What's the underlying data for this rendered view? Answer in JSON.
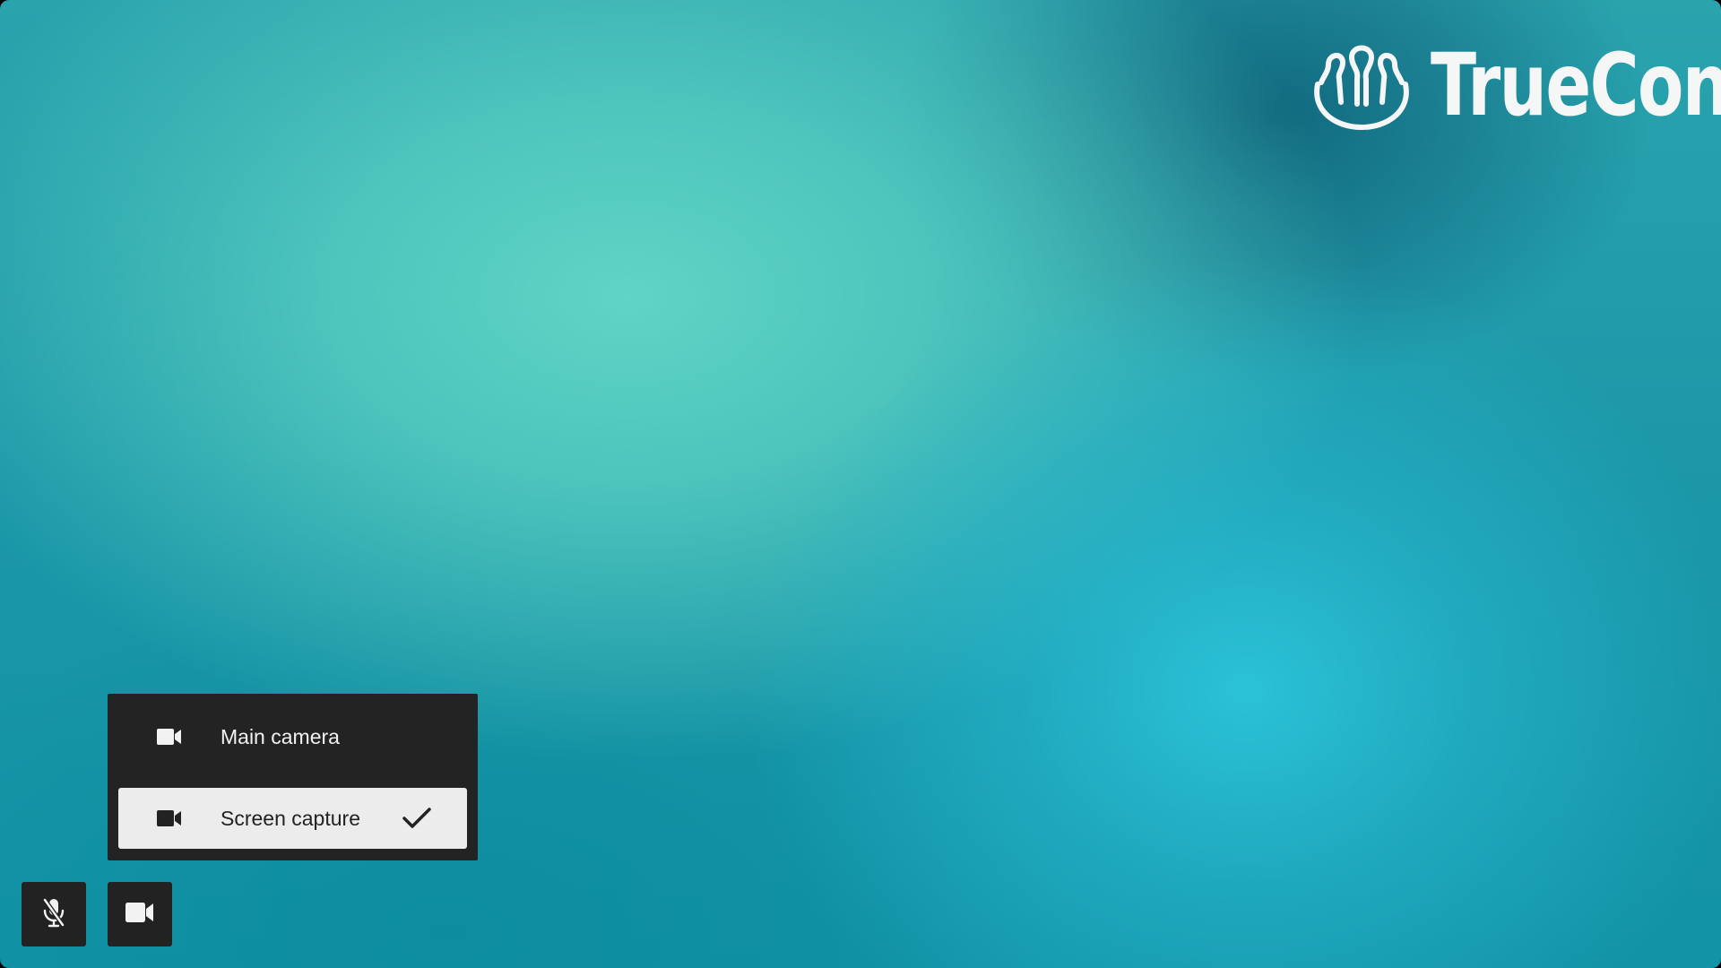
{
  "brand": {
    "name": "TrueConf",
    "logo_icon": "three-people-icon"
  },
  "source_menu": {
    "items": [
      {
        "label": "Main camera",
        "icon": "video-camera-icon",
        "selected": false
      },
      {
        "label": "Screen capture",
        "icon": "video-camera-icon",
        "selected": true
      }
    ]
  },
  "toolbar": {
    "microphone": {
      "icon": "microphone-muted-icon",
      "state": "muted"
    },
    "camera": {
      "icon": "video-camera-icon"
    }
  },
  "colors": {
    "panel": "#232323",
    "selected_item": "#ececec",
    "background_teal": "#1b97a8",
    "logo": "#f5f7f7"
  }
}
